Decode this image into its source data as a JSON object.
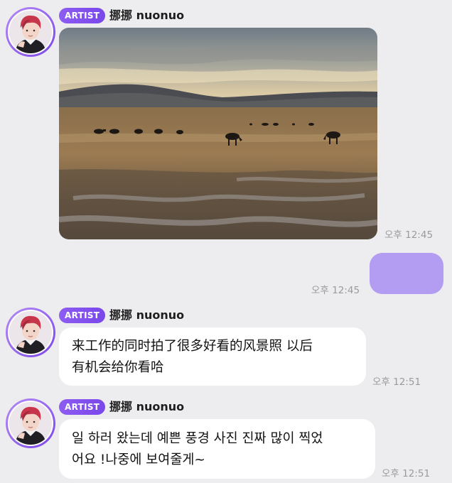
{
  "messages": [
    {
      "sender_badge": "ARTIST",
      "sender_name": "挪挪 nuonuo",
      "type": "image",
      "time": "오후 12:45"
    },
    {
      "type": "outgoing",
      "time": "오후 12:45"
    },
    {
      "sender_badge": "ARTIST",
      "sender_name": "挪挪 nuonuo",
      "type": "text",
      "lines": [
        "来工作的同时拍了很多好看的风景照 以后",
        "有机会给你看哈"
      ],
      "time": "오후 12:51"
    },
    {
      "sender_badge": "ARTIST",
      "sender_name": "挪挪 nuonuo",
      "type": "text",
      "lines": [
        "일 하러 왔는데 예쁜 풍경 사진 진짜 많이 찍었",
        "어요 !나중에 보여줄게~"
      ],
      "time": "오후 12:51"
    }
  ],
  "colors": {
    "background": "#ededf0",
    "badge": "#8457ee",
    "outgoing_bubble": "#b29df3",
    "avatar_ring": "#9a66f0"
  },
  "icons": {
    "avatar": "artist-avatar-photo"
  }
}
